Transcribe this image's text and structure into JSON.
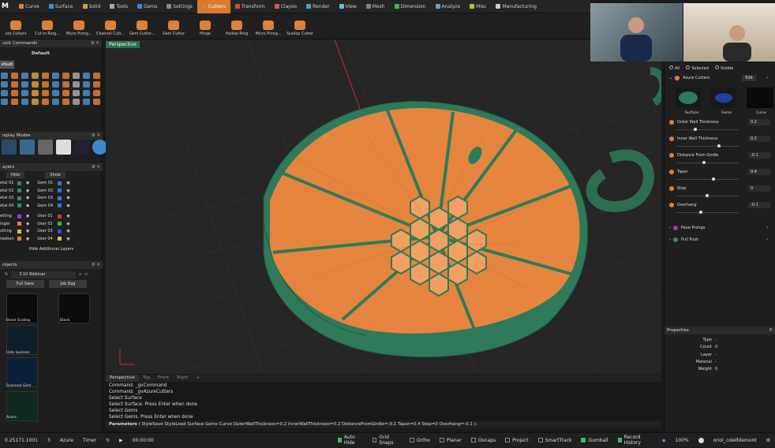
{
  "app": {
    "logo": "M"
  },
  "menu": [
    {
      "label": "Curve",
      "color": "#e08038"
    },
    {
      "label": "Surface",
      "color": "#4a90c8"
    },
    {
      "label": "Solid",
      "color": "#d4a040"
    },
    {
      "label": "Tools",
      "color": "#aaaaaa"
    },
    {
      "label": "Gems",
      "color": "#3a8ad0"
    },
    {
      "label": "Settings",
      "color": "#888888"
    },
    {
      "label": "Cutters",
      "color": "#e08038",
      "active": true
    },
    {
      "label": "Transform",
      "color": "#c05050"
    },
    {
      "label": "Clayoo",
      "color": "#d06060"
    },
    {
      "label": "Render",
      "color": "#50a0d0"
    },
    {
      "label": "View",
      "color": "#60c0e0"
    },
    {
      "label": "Mesh",
      "color": "#8080a0"
    },
    {
      "label": "Dimension",
      "color": "#50b060"
    },
    {
      "label": "Analyze",
      "color": "#70a0c0"
    },
    {
      "label": "Misc",
      "color": "#c0c040"
    },
    {
      "label": "Manufacturing",
      "color": "#cccccc"
    }
  ],
  "toolbar": [
    "ure Cutters",
    "Cut to Ring...",
    "Micro Prong...",
    "Channel Cutt...",
    "Gem Cutter...",
    "Gem Cutter",
    "Hinge",
    "Hollow Ring",
    "Micro Prong...",
    "Scallop Cutter"
  ],
  "left": {
    "quick_commands": "uick Commands",
    "default_label": "Default",
    "default_tab": "efault",
    "display_modes": "isplay Modes",
    "layers": "ayers",
    "hide": "Hide",
    "show": "Show",
    "layer_rows_left": [
      "etal 01",
      "etal 02",
      "etal 03",
      "etal 04",
      "etting",
      "inger",
      "utting",
      "reation"
    ],
    "layer_rows_right": [
      "Gem 01",
      "Gem 02",
      "Gem 03",
      "Gem 04",
      "User 01",
      "User 02",
      "User 03",
      "User 04"
    ],
    "layer_colors_left": [
      "#2e8a6a",
      "#2e8a6a",
      "#2e8a6a",
      "#2e8a6a",
      "#9a3ac0",
      "#e08038",
      "#e0c040",
      "#e08038"
    ],
    "layer_colors_right": [
      "#4070e0",
      "#4070e0",
      "#4070e0",
      "#4070e0",
      "#e03030",
      "#30c030",
      "#3050e0",
      "#e0c040"
    ],
    "add_layers": "Hide Additional Layers",
    "projects": "rojects",
    "project_select": "3.10 Webinar",
    "full_save": "Full Save",
    "job_bag": "Job Bag",
    "thumbs": [
      "Bezel Scaling",
      "Blank",
      "Hide boolean",
      "Scanned Gem",
      "Azure"
    ]
  },
  "viewport": {
    "tab": "Perspective"
  },
  "right": {
    "radio": [
      "All",
      "Selected",
      "Visible"
    ],
    "azure_cutters": "Azure Cutters",
    "edit": "Edit",
    "thumbs": [
      "Surface",
      "Gems",
      "Curve"
    ],
    "params": [
      {
        "label": "Outer Wall Thickness",
        "value": "0.2"
      },
      {
        "label": "Inner Wall Thickness",
        "value": "0.2"
      },
      {
        "label": "Distance From Girdle",
        "value": "-0.1"
      },
      {
        "label": "Taper",
        "value": "0.4"
      },
      {
        "label": "Step",
        "value": "0"
      },
      {
        "label": "Overhang",
        "value": "-0.1"
      }
    ],
    "slider_levels": [
      0.3,
      0.7,
      0.45,
      0.6,
      0.5,
      0.4
    ],
    "pave_prongs": "Pave Prongs",
    "pull_push": "Pull Push",
    "properties": "Properties",
    "props": [
      {
        "k": "Type",
        "v": "-"
      },
      {
        "k": "Count",
        "v": "0"
      },
      {
        "k": "Layer",
        "v": "-"
      },
      {
        "k": "Material",
        "v": "-"
      },
      {
        "k": "Weight",
        "v": "0"
      }
    ]
  },
  "cmd": {
    "tabs": [
      "Perspective",
      "Top",
      "Front",
      "Right",
      "+"
    ],
    "lines": [
      "Command: _gvCommand",
      "Command: _gvAzureCutters",
      "Select Surface",
      "Select Surface. Press Enter when done",
      "Select Gems",
      "Select Gems. Press Enter when done"
    ],
    "params_label": "Parameters",
    "params_text": "( StyleSave  StyleLoad  Surface  Gems  Curve  OuterWallThickness=0.2  InnerWallThickness=0.2  DistanceFromGirdle=-0.1  Taper=0.4  Step=0  Overhang=-0.1 ):"
  },
  "status": {
    "coords": "0.25171.1001",
    "count": "3",
    "material": "Azure",
    "timer": "Timer",
    "time": "00:00:00",
    "auto_hide": "Auto Hide",
    "grid_snaps": "Grid Snaps",
    "ortho": "Ortho",
    "planar": "Planar",
    "osnaps": "Osnaps",
    "project": "Project",
    "smarttrack": "SmartTrack",
    "gumball": "Gumball",
    "record_history": "Record History",
    "zoom": "100%",
    "user": "oriol_colelldemont"
  }
}
